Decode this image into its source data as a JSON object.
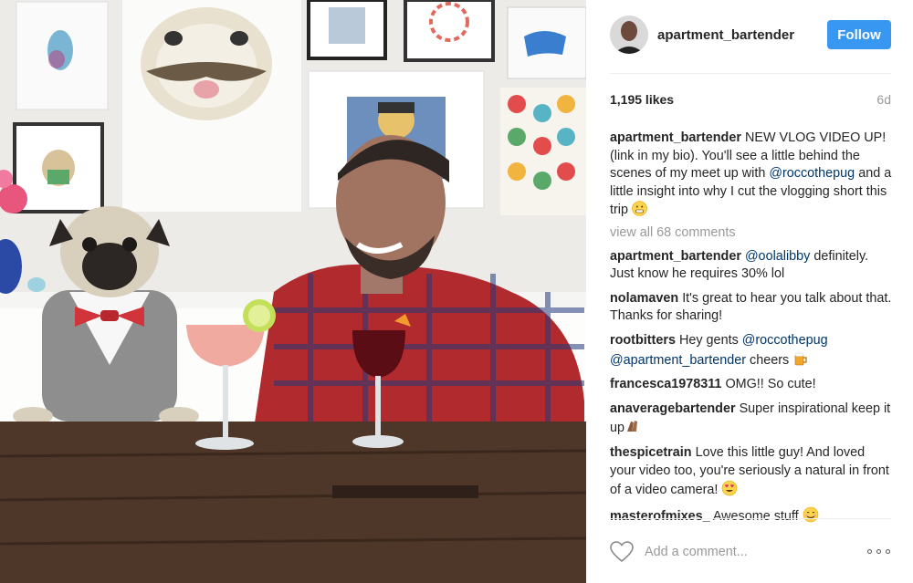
{
  "post": {
    "author": "apartment_bartender",
    "follow_label": "Follow",
    "likes": "1,195 likes",
    "age": "6d",
    "caption": {
      "user": "apartment_bartender",
      "part1": "NEW VLOG VIDEO UP! (link in my bio). You'll see a little behind the scenes of my meet up with",
      "mention": "@roccothepug",
      "part2": "and a little insight into why I cut the vlogging short this trip",
      "emoji_icon": "grimacing-face-emoji"
    },
    "view_all_comments": "view all 68 comments",
    "comments": [
      {
        "user": "apartment_bartender",
        "mention": "@oolalibby",
        "text": "definitely. Just know he requires 30% lol"
      },
      {
        "user": "nolamaven",
        "text": "It's great to hear you talk about that. Thanks for sharing!"
      },
      {
        "user": "rootbitters",
        "text1": "Hey gents",
        "mention1": "@roccothepug",
        "mention2": "@apartment_bartender",
        "text2": "cheers",
        "emoji_icon": "beer-mug-emoji"
      },
      {
        "user": "francesca1978311",
        "text": "OMG!! So cute!"
      },
      {
        "user": "anaveragebartender",
        "text": "Super inspirational keep it up",
        "emoji_icon": "clapping-hands-emoji"
      },
      {
        "user": "thespicetrain",
        "text": "Love this little guy! And loved your video too, you're seriously a natural in front of a video camera!",
        "emoji_icon": "heart-eyes-emoji"
      },
      {
        "user": "masterofmixes_",
        "text": "Awesome stuff",
        "emoji_icon": "smiling-face-emoji"
      }
    ],
    "add_comment_placeholder": "Add a comment...",
    "colors": {
      "follow_button": "#3897f0",
      "mention": "#003569",
      "muted": "#999999"
    },
    "icons": {
      "like": "heart-outline-icon",
      "more": "more-options-icon"
    }
  }
}
